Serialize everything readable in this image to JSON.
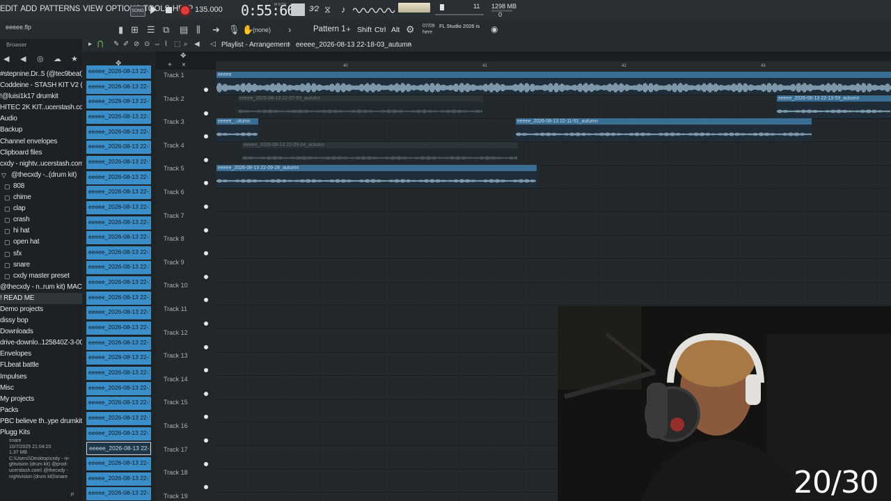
{
  "menu": [
    "EDIT",
    "ADD",
    "PATTERNS",
    "VIEW",
    "OPTIONS",
    "TOOLS",
    "HELP"
  ],
  "transport": {
    "song_label": "SONG",
    "tempo": "135.000",
    "time": "0:55:66",
    "time_unit": "M:S:CS",
    "polyphony": "11",
    "memory": "1298 MB",
    "cpu_value": "0"
  },
  "project": {
    "file_name": "eeeee.flp"
  },
  "toolbar": {
    "pattern_none": "(none)",
    "pattern_name": "Pattern 1",
    "mod_keys": [
      "Shift",
      "Ctrl",
      "Alt"
    ],
    "hint_date": "07/09",
    "hint_here": "here",
    "hint_text": "FL Studio 2026 is"
  },
  "browser": {
    "title": "Browser",
    "items": [
      {
        "label": "#stepnine.Dr..5 (@tec9beat)",
        "sub": false
      },
      {
        "label": "Coddeine - STASH KIT V2 (",
        "sub": false
      },
      {
        "label": "!@luisi1k17 drumkit",
        "sub": false
      },
      {
        "label": "HITEC 2K KIT..ucerstash.com",
        "sub": false
      },
      {
        "label": "Audio",
        "sub": false
      },
      {
        "label": "Backup",
        "sub": false
      },
      {
        "label": "Channel envelopes",
        "sub": false
      },
      {
        "label": "Clipboard files",
        "sub": false
      },
      {
        "label": "cxdy - nightv..ucerstash.com",
        "sub": false
      },
      {
        "label": "@thecxdy -..(drum kit)",
        "sub": false,
        "folder_open": true
      },
      {
        "label": "808",
        "sub": true
      },
      {
        "label": "chime",
        "sub": true
      },
      {
        "label": "clap",
        "sub": true
      },
      {
        "label": "crash",
        "sub": true
      },
      {
        "label": "hi hat",
        "sub": true
      },
      {
        "label": "open hat",
        "sub": true
      },
      {
        "label": "sfx",
        "sub": true
      },
      {
        "label": "snare",
        "sub": true
      },
      {
        "label": "cxdy master preset",
        "sub": true
      },
      {
        "label": "@thecxdy - n..rum kit) MAC",
        "sub": false
      },
      {
        "label": "! READ ME",
        "sub": false,
        "selected": true
      },
      {
        "label": "Demo projects",
        "sub": false
      },
      {
        "label": "dissy bop",
        "sub": false
      },
      {
        "label": "Downloads",
        "sub": false
      },
      {
        "label": "drive-downlo..125840Z-3-001",
        "sub": false
      },
      {
        "label": "Envelopes",
        "sub": false
      },
      {
        "label": "FLbeat battle",
        "sub": false
      },
      {
        "label": "Impulses",
        "sub": false
      },
      {
        "label": "Misc",
        "sub": false
      },
      {
        "label": "My projects",
        "sub": false
      },
      {
        "label": "Packs",
        "sub": false
      },
      {
        "label": "PBC believe th..ype drumkit 1",
        "sub": false
      },
      {
        "label": "Plugg Kits",
        "sub": false
      }
    ],
    "info": {
      "name": "snare",
      "date": "10/7/2025 21:04:20",
      "size": "1.37 MB",
      "path_lines": [
        "C:\\Users\\\\Desktop\\cxdy - ni-",
        "ghtvision (drum kit) @prod-",
        "ucerstash.com\\ @thecxdy -",
        "nightvision (drum kit)\\snare"
      ]
    }
  },
  "playlist": {
    "title": "Playlist - Arrangement",
    "arrangement": "eeeee_2026-08-13 22-18-03_autumn",
    "bar_numbers": [
      "40",
      "41",
      "42",
      "43"
    ],
    "tracks": [
      "Track 1",
      "Track 2",
      "Track 3",
      "Track 4",
      "Track 5",
      "Track 6",
      "Track 7",
      "Track 8",
      "Track 9",
      "Track 10",
      "Track 11",
      "Track 12",
      "Track 13",
      "Track 14",
      "Track 15",
      "Track 16",
      "Track 17",
      "Track 18",
      "Track 19"
    ],
    "picker_clip_label": "eeeee_2026-08-13 22-1...",
    "picker_count": 29,
    "picker_selected_index": 25,
    "clips": [
      {
        "track": 0,
        "label": "eeeee",
        "dim": false
      },
      {
        "track": 1,
        "label": "eeeee_2026-08-13 22-07-53_autumn",
        "dim": true
      },
      {
        "track": 1,
        "label": "eeeee_2026-08-13 22-13-59_autumn",
        "dim": false
      },
      {
        "track": 2,
        "label": "eeeee_..utumn",
        "dim": false
      },
      {
        "track": 2,
        "label": "eeeee_2026-08-13 22-11-51_autumn",
        "dim": false
      },
      {
        "track": 3,
        "label": "eeeee_2026-08-13 22-09-04_autumn",
        "dim": true
      },
      {
        "track": 4,
        "label": "eeeee_2026-08-13 22-09-28_autumn",
        "dim": false
      }
    ]
  },
  "overlay": {
    "counter": "20/30"
  },
  "colors": {
    "accent_clip": "#3b8fc9",
    "record": "#e33a3a",
    "background": "#1b1f22"
  },
  "icons": [
    "play-icon",
    "stop-icon",
    "record-icon",
    "search-icon",
    "globe-icon",
    "hint-icon",
    "metronome-icon",
    "loop-icon"
  ]
}
